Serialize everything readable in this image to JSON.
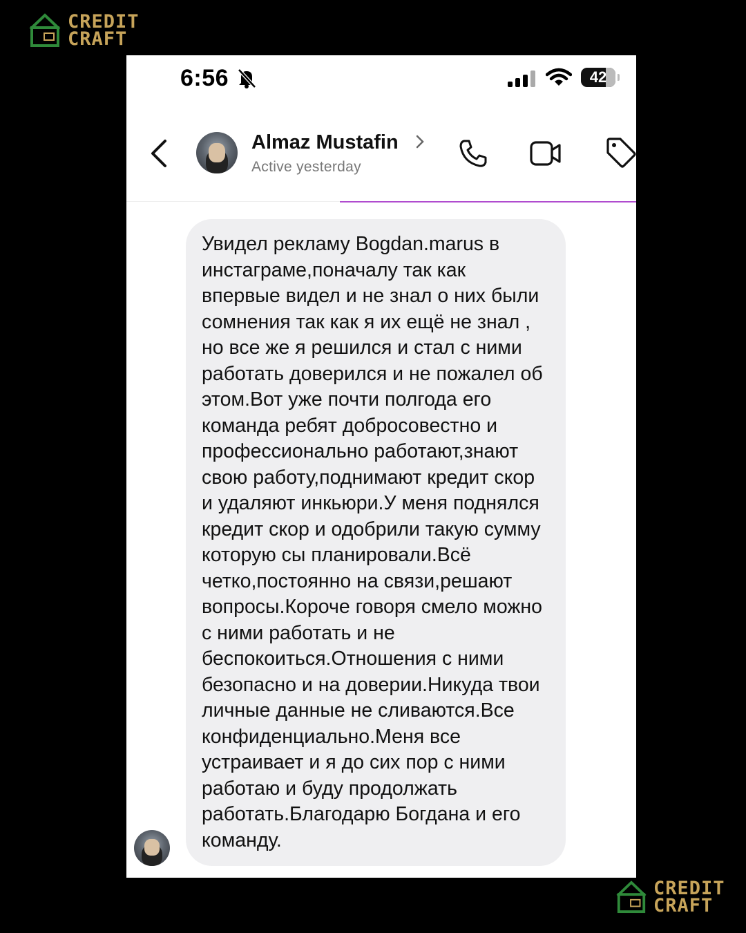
{
  "brand": {
    "line1": "CREDIT",
    "line2": "CRAFT",
    "color": "#c7a45a"
  },
  "status_bar": {
    "time": "6:56",
    "battery": "42",
    "icons": [
      "bell-slash-icon",
      "signal-icon",
      "wifi-icon",
      "battery-icon"
    ]
  },
  "header": {
    "contact_name": "Almaz Mustafin",
    "contact_status": "Active yesterday",
    "icons": [
      "back-chevron-icon",
      "phone-icon",
      "video-camera-icon",
      "tag-icon"
    ]
  },
  "message": {
    "text": "Увидел рекламу Bogdan.marus в\nинстаграме,поначалу так как\nвпервые видел и не знал о них были\nсомнения так как я их ещё не знал ,\nно все же я решился и стал с ними\nработать доверился и не пожалел об\nэтом.Вот уже почти полгода его\nкоманда ребят добросовестно и\nпрофессионально работают,знают\nсвою работу,поднимают кредит скор\nи удаляют инкьюри.У меня поднялся\nкредит скор и одобрили такую сумму\nкоторую сы планировали.Всё\nчетко,постоянно на связи,решают\nвопросы.Короче говоря смело можно\nс ними работать и не\nбеспокоиться.Отношения с ними\nбезопасно и на доверии.Никуда твои\nличные данные не сливаются.Все\nконфиденциально.Меня все\nустраивает и я до сих пор с ними\nработаю и буду продолжать\nработать.Благодарю Богдана и его\nкоманду."
  },
  "colors": {
    "accent_line": "#b04ccf",
    "bubble": "#efeff1"
  }
}
